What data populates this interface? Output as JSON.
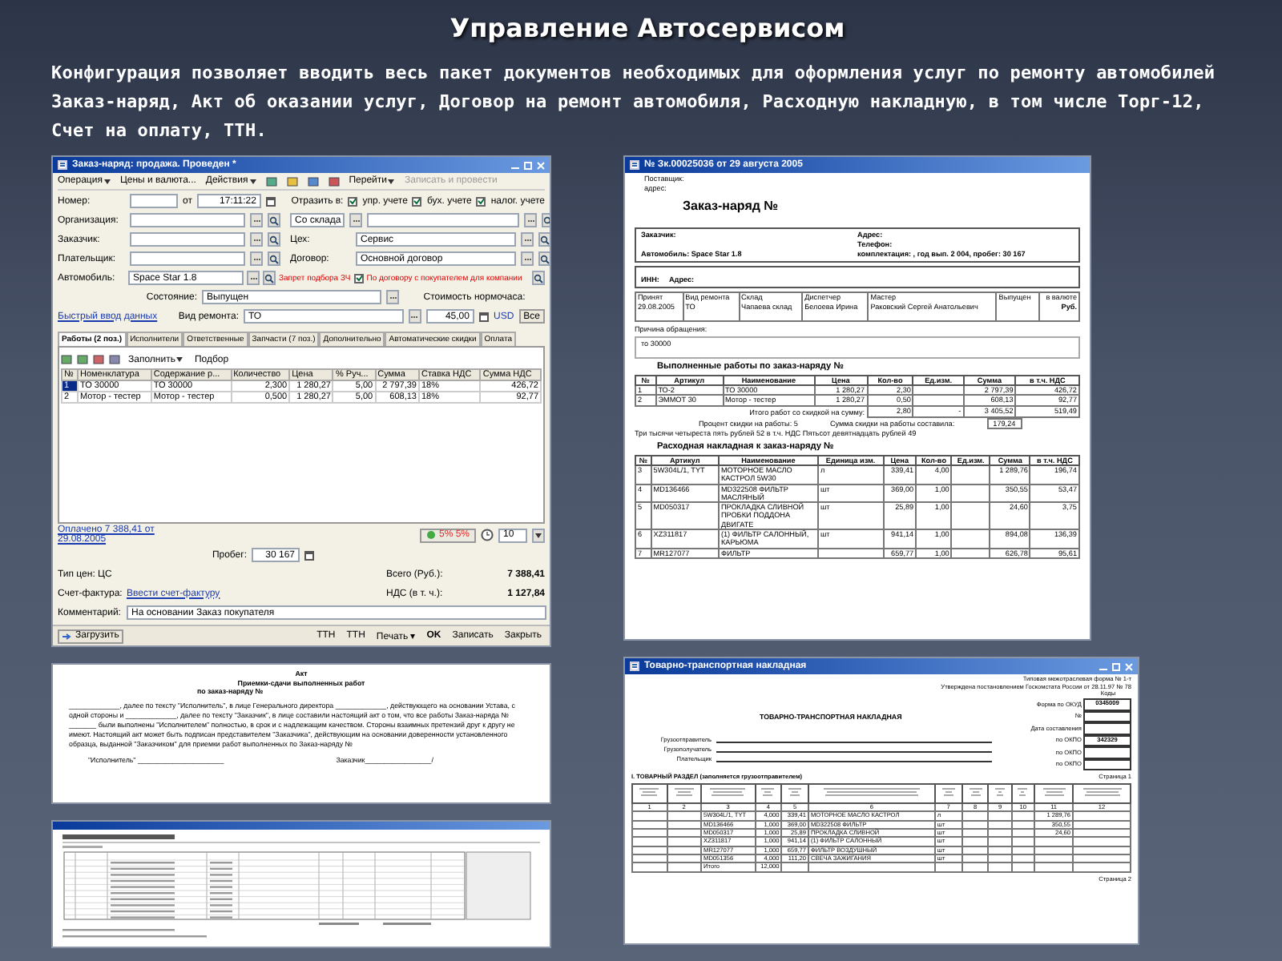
{
  "title": "Управление Автосервисом",
  "intro": "Конфигурация позволяет вводить весь пакет документов необходимых для оформления услуг по ремонту автомобилей Заказ-наряд, Акт об оказании услуг, Договор на ремонт автомобиля, Расходную накладную, в том числе Торг-12, Счет на оплату, ТТН.",
  "order_form": {
    "title": "Заказ-наряд: продажа. Проведен *",
    "menu": [
      {
        "label": "Операция",
        "dropdown": true,
        "disabled": false
      },
      {
        "label": "Цены и валюта...",
        "dropdown": false,
        "disabled": false
      },
      {
        "label": "Действия",
        "dropdown": true,
        "disabled": false
      },
      {
        "label": "Перейти",
        "dropdown": true,
        "disabled": false
      },
      {
        "label": "Записать и провести",
        "dropdown": false,
        "disabled": true
      }
    ],
    "number": {
      "label": "Номер:"
    },
    "date": {
      "label": "от",
      "value": "17:11:22"
    },
    "reflect": {
      "label": "Отразить в:",
      "options": [
        {
          "label": "упр. учете",
          "checked": true
        },
        {
          "label": "бух. учете",
          "checked": true
        },
        {
          "label": "налог. учете",
          "checked": true
        }
      ]
    },
    "organization": {
      "label": "Организация:"
    },
    "warehouse": {
      "value": "Со склада"
    },
    "customer": {
      "label": "Заказчик:"
    },
    "workshop": {
      "label": "Цех:",
      "value": "Сервис"
    },
    "payer": {
      "label": "Плательщик:"
    },
    "contract": {
      "label": "Договор:",
      "value": "Основной договор"
    },
    "car": {
      "label": "Автомобиль:",
      "value": "Space Star 1.8"
    },
    "parts_ban": {
      "label": "Запрет подбора ЗЧ",
      "checked": true
    },
    "price_note": "По договору с покупателем для компании",
    "state": {
      "label": "Состояние:",
      "value": "Выпущен"
    },
    "hour_cost": {
      "label": "Стоимость нормочаса:",
      "value": "45,00",
      "currency": "USD",
      "button": "Все"
    },
    "quick_input": "Быстрый ввод данных",
    "repair_kind": {
      "label": "Вид ремонта:",
      "value": "ТО"
    },
    "tabs": [
      {
        "label": "Работы (2 поз.)",
        "selected": true
      },
      {
        "label": "Исполнители",
        "selected": false
      },
      {
        "label": "Ответственные",
        "selected": false
      },
      {
        "label": "Запчасти (7 поз.)",
        "selected": false
      },
      {
        "label": "Дополнительно",
        "selected": false
      },
      {
        "label": "Автоматические скидки",
        "selected": false
      },
      {
        "label": "Оплата",
        "selected": false
      }
    ],
    "tab_toolbar": [
      {
        "label": "Заполнить",
        "dropdown": true
      },
      {
        "label": "Подбор",
        "dropdown": false
      }
    ],
    "table": {
      "columns": [
        "№",
        "Номенклатура",
        "Содержание р...",
        "Количество",
        "Цена",
        "% Руч...",
        "Сумма",
        "Ставка НДС",
        "Сумма НДС"
      ],
      "rows": [
        {
          "selected": true,
          "cells": [
            "1",
            "ТО 30000",
            "ТО 30000",
            "2,300",
            "1 280,27",
            "5,00",
            "2 797,39",
            "18%",
            "426,72"
          ]
        },
        {
          "selected": false,
          "cells": [
            "2",
            "Мотор - тестер",
            "Мотор - тестер",
            "0,500",
            "1 280,27",
            "5,00",
            "608,13",
            "18%",
            "92,77"
          ]
        }
      ]
    },
    "paid_link": "Оплачено 7 388,41 от 29.08.2005",
    "discount": "5% 5%",
    "discount_count": "10",
    "mileage": {
      "label": "Пробег:",
      "value": "30 167"
    },
    "price_type": {
      "label": "Тип цен:",
      "value": "ЦС"
    },
    "invoice": {
      "label": "Счет-фактура:",
      "link": "Ввести счет-фактуру"
    },
    "totals": [
      {
        "label": "Всего (Руб.):",
        "value": "7 388,41"
      },
      {
        "label": "НДС (в т. ч.):",
        "value": "1 127,84"
      }
    ],
    "comment": {
      "label": "Комментарий:",
      "value": "На основании Заказ покупателя"
    },
    "load_button": "Загрузить",
    "footer_buttons": [
      {
        "label": "ТТН",
        "kind": "plain"
      },
      {
        "label": "ТТН",
        "kind": "plain"
      },
      {
        "label": "Печать ▾",
        "kind": "plain"
      },
      {
        "label": "OK",
        "kind": "default"
      },
      {
        "label": "Записать",
        "kind": "plain"
      },
      {
        "label": "Закрыть",
        "kind": "plain"
      }
    ]
  },
  "order_printout": {
    "title": "№ Зк.00025036 от 29 августа 2005",
    "supplier": [
      "Поставщик:",
      "адрес:"
    ],
    "heading": "Заказ-наряд №",
    "customer_box": [
      {
        "left": "Заказчик:",
        "right": "Адрес:"
      },
      {
        "right": "Телефон:"
      },
      {
        "left": "Автомобиль: Space Star 1.8",
        "right": "комплектация: , год вып. 2 004, пробег: 30 167"
      }
    ],
    "inn_box": [
      "ИНН:",
      "Адрес:"
    ],
    "acceptance": [
      {
        "label": "Принят",
        "value": "29.08.2005"
      },
      {
        "label": "Вид ремонта",
        "value": "ТО"
      },
      {
        "label": "Склад",
        "value": "Чапаева склад"
      },
      {
        "label": "Диспетчер",
        "value": "Белоева Ирина"
      },
      {
        "label": "Мастер",
        "value": "Раковский Сергей Анатольевич"
      },
      {
        "label": "Выпущен"
      }
    ],
    "currency": {
      "label": "в валюте",
      "value": "Руб."
    },
    "reason": {
      "label": "Причина обращения:",
      "value": "то 30000"
    },
    "works_heading": "Выполненные работы по заказ-наряду №",
    "works_columns": [
      "№",
      "Артикул",
      "Наименование",
      "Цена",
      "Кол-во",
      "Ед.изм.",
      "Сумма",
      "в т.ч. НДС"
    ],
    "works_rows": [
      {
        "no": "1",
        "article": "ТО-2",
        "name": "ТО 30000",
        "price": "1 280,27",
        "qty": "2,30",
        "sum": "2 797,39",
        "vat": "426,72"
      },
      {
        "no": "2",
        "article": "ЭММОТ 30",
        "name": "Мотор - тестер",
        "price": "1 280,27",
        "qty": "0,50",
        "sum": "608,13",
        "vat": "92,77"
      }
    ],
    "works_total": {
      "label": "Итого работ со скидкой на сумму:",
      "values": [
        "2,80",
        "-",
        "3 405,52",
        "519,49"
      ]
    },
    "discount_lines": [
      "Процент скидки на работы: 5",
      "Сумма скидки на работы составила:",
      "179,24"
    ],
    "amount_words": "Три тысячи четыреста пять рублей 52   в т.ч. НДС Пятьсот девятнадцать рублей 49",
    "parts_heading": "Расходная накладная к заказ-наряду №",
    "parts_columns": [
      "№",
      "Артикул",
      "Наименование",
      "Единица изм.",
      "Цена",
      "Кол-во",
      "Ед.изм.",
      "Сумма",
      "в т.ч. НДС"
    ],
    "parts_rows": [
      {
        "no": "3",
        "article": "5W304L/1, TYT",
        "name": "МОТОРНОЕ МАСЛО КАСТРОЛ 5W30",
        "measure": "л",
        "price": "339,41",
        "qty": "4,00",
        "sum": "1 289,76",
        "vat": "196,74"
      },
      {
        "no": "4",
        "article": "MD136466",
        "name": "MD322508 ФИЛЬТР МАСЛЯНЫЙ",
        "measure": "шт",
        "price": "369,00",
        "qty": "1,00",
        "sum": "350,55",
        "vat": "53,47"
      },
      {
        "no": "5",
        "article": "MD050317",
        "name": "ПРОКЛАДКА СЛИВНОЙ ПРОБКИ ПОДДОНА ДВИГАТЕ",
        "measure": "шт",
        "price": "25,89",
        "qty": "1,00",
        "sum": "24,60",
        "vat": "3,75"
      },
      {
        "no": "6",
        "article": "XZ311817",
        "name": "(1) ФИЛЬТР САЛОННЫЙ, КАРЬЮМА",
        "measure": "шт",
        "price": "941,14",
        "qty": "1,00",
        "sum": "894,08",
        "vat": "136,39"
      },
      {
        "no": "7",
        "article": "MR127077",
        "name": "ФИЛЬТР",
        "price": "659,77",
        "qty": "1,00",
        "sum": "626,78",
        "vat": "95,61"
      }
    ]
  },
  "act_printout": {
    "title": "Акт",
    "subtitle": "Приемки-сдачи выполненных работ",
    "order": "по заказ-наряду №",
    "text": "_____________, далее по тексту \"Исполнитель\", в лице Генерального директора _____________, действующего на основании Устава, с одной стороны и _____________, далее по тексту \"Заказчик\", в лице составили настоящий акт о том, что все работы Заказ-наряда № _______ были выполнены \"Исполнителем\" полностью, в срок и с надлежащим качеством. Стороны взаимных претензий друг к другу не имеют. Настоящий акт может быть подписан представителем \"Заказчика\", действующим на основании доверенности установленного образца, выданной \"Заказчиком\" для приемки работ выполненных по Заказ-наряду №",
    "signatures": [
      "\"Исполнитель\" ______________________",
      "Заказчик_________________/"
    ]
  },
  "ttn_printout": {
    "title": "Товарно-транспортная накладная",
    "form_note": [
      "Типовая межотраслевая форма № 1-т",
      "Утверждена постановлением Госкомстата России от 28.11.97 № 78"
    ],
    "heading": "ТОВАРНО-ТРАНСПОРТНАЯ НАКЛАДНАЯ",
    "codes_label": "Коды",
    "codes": [
      {
        "label": "Форма по ОКУД",
        "value": "0345009"
      },
      {
        "label": "№"
      },
      {
        "label": "Дата составления"
      },
      {
        "label": "по ОКПО",
        "value": "342329"
      },
      {
        "label": "по ОКПО"
      },
      {
        "label": "по ОКПО"
      }
    ],
    "parties": [
      "Грузоотправитель",
      "Грузополучатель",
      "Плательщик"
    ],
    "section": "I. ТОВАРНЫЙ РАЗДЕЛ (заполняется грузоотправителем)",
    "page": "Страница 1",
    "column_numbers": [
      "1",
      "2",
      "3",
      "4",
      "5",
      "6",
      "7",
      "8",
      "9",
      "10",
      "11",
      "12"
    ],
    "rows": [
      {
        "article": "5W304L/1, TYT",
        "quantity": "4,000",
        "price": "339,41",
        "name": "МОТОРНОЕ МАСЛО КАСТРОЛ",
        "unit": "л",
        "sum": "1 289,76"
      },
      {
        "article": "MD136466",
        "quantity": "1,000",
        "price": "369,00",
        "name": "MD322508 ФИЛЬТР",
        "unit": "шт",
        "sum": "350,55"
      },
      {
        "article": "MD050317",
        "quantity": "1,000",
        "price": "25,89",
        "name": "ПРОКЛАДКА СЛИВНОЙ",
        "unit": "шт",
        "sum": "24,60"
      },
      {
        "article": "XZ311817",
        "quantity": "1,000",
        "price": "941,14",
        "name": "(1) ФИЛЬТР САЛОННЫЙ",
        "unit": "шт"
      },
      {
        "article": "MR127077",
        "quantity": "1,000",
        "price": "659,77",
        "name": "ФИЛЬТР ВОЗДУШНЫЙ",
        "unit": "шт"
      },
      {
        "article": "MD051356",
        "quantity": "4,000",
        "price": "111,20",
        "name": "СВЕЧА ЗАЖИГАНИЯ",
        "unit": "шт"
      }
    ],
    "total": {
      "article": "Итого",
      "quantity": "12,000"
    },
    "page2": "Страница 2"
  }
}
